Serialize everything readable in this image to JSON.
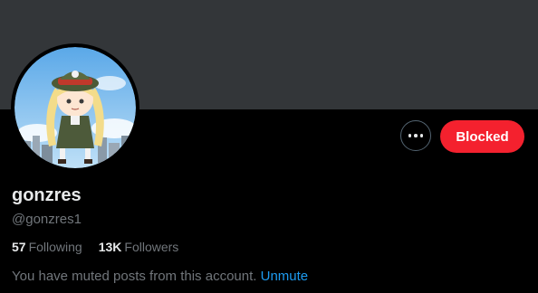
{
  "profile": {
    "display_name": "gonzres",
    "handle": "@gonzres1",
    "avatar_icon": "profile-avatar-anime-girl"
  },
  "actions": {
    "more_icon": "more-dots-icon",
    "blocked_label": "Blocked"
  },
  "stats": {
    "following_count": "57",
    "following_label": "Following",
    "followers_count": "13K",
    "followers_label": "Followers"
  },
  "notice": {
    "text": "You have muted posts from this account.",
    "link_label": "Unmute"
  },
  "colors": {
    "banner": "#333639",
    "blocked": "#f4212e",
    "link": "#1d9bf0",
    "secondary_text": "#71767b"
  }
}
